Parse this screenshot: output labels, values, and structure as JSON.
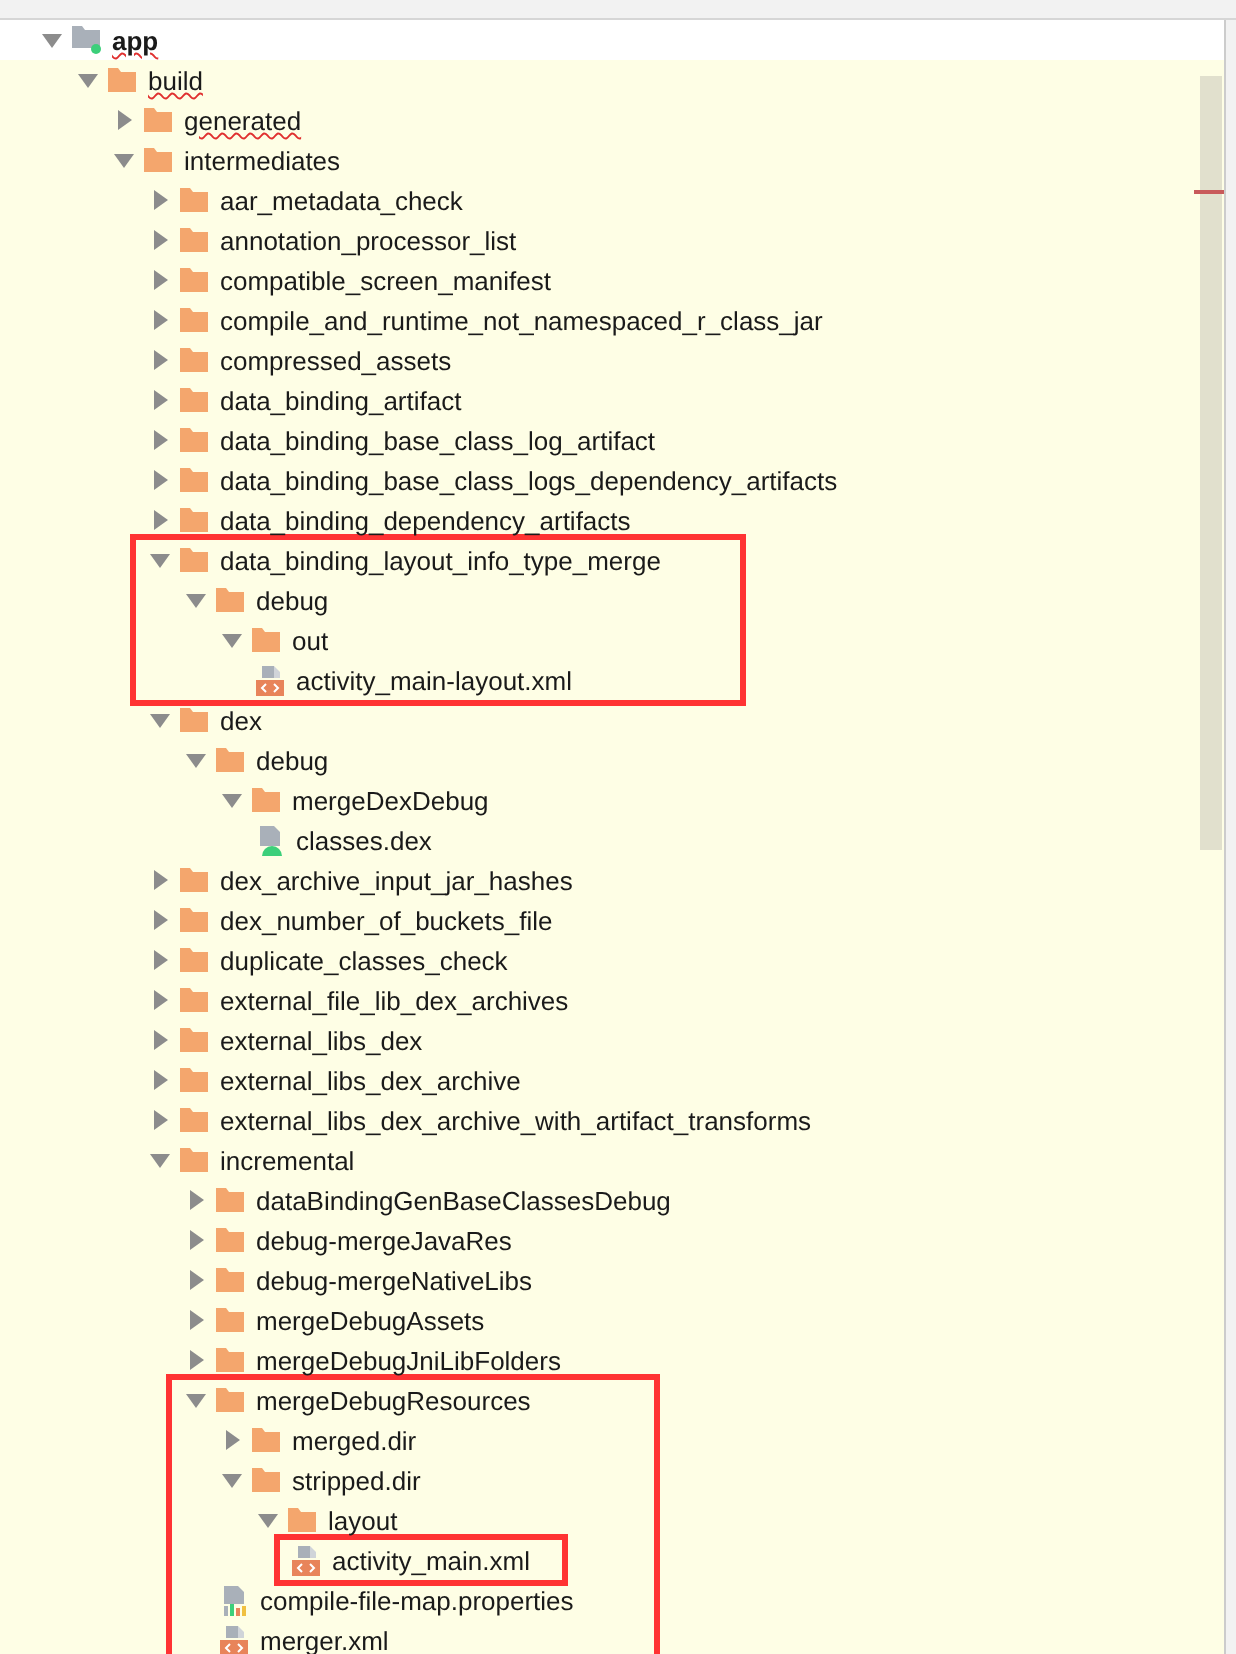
{
  "tree": [
    {
      "label": "app",
      "kind": "module",
      "expanded": true,
      "spellcheck_error": true,
      "children": [
        {
          "label": "build",
          "kind": "folder",
          "expanded": true,
          "spellcheck_error": true,
          "children": [
            {
              "label": "generated",
              "kind": "folder",
              "expanded": false,
              "spellcheck_error": true
            },
            {
              "label": "intermediates",
              "kind": "folder",
              "expanded": true,
              "children": [
                {
                  "label": "aar_metadata_check",
                  "kind": "folder",
                  "expanded": false
                },
                {
                  "label": "annotation_processor_list",
                  "kind": "folder",
                  "expanded": false
                },
                {
                  "label": "compatible_screen_manifest",
                  "kind": "folder",
                  "expanded": false
                },
                {
                  "label": "compile_and_runtime_not_namespaced_r_class_jar",
                  "kind": "folder",
                  "expanded": false
                },
                {
                  "label": "compressed_assets",
                  "kind": "folder",
                  "expanded": false
                },
                {
                  "label": "data_binding_artifact",
                  "kind": "folder",
                  "expanded": false
                },
                {
                  "label": "data_binding_base_class_log_artifact",
                  "kind": "folder",
                  "expanded": false
                },
                {
                  "label": "data_binding_base_class_logs_dependency_artifacts",
                  "kind": "folder",
                  "expanded": false
                },
                {
                  "label": "data_binding_dependency_artifacts",
                  "kind": "folder",
                  "expanded": false
                },
                {
                  "label": "data_binding_layout_info_type_merge",
                  "kind": "folder",
                  "expanded": true,
                  "highlighted": true,
                  "children": [
                    {
                      "label": "debug",
                      "kind": "folder",
                      "expanded": true,
                      "children": [
                        {
                          "label": "out",
                          "kind": "folder",
                          "expanded": true,
                          "children": [
                            {
                              "label": "activity_main-layout.xml",
                              "kind": "xml"
                            }
                          ]
                        }
                      ]
                    }
                  ]
                },
                {
                  "label": "dex",
                  "kind": "folder",
                  "expanded": true,
                  "children": [
                    {
                      "label": "debug",
                      "kind": "folder",
                      "expanded": true,
                      "children": [
                        {
                          "label": "mergeDexDebug",
                          "kind": "folder",
                          "expanded": true,
                          "children": [
                            {
                              "label": "classes.dex",
                              "kind": "dex"
                            }
                          ]
                        }
                      ]
                    }
                  ]
                },
                {
                  "label": "dex_archive_input_jar_hashes",
                  "kind": "folder",
                  "expanded": false
                },
                {
                  "label": "dex_number_of_buckets_file",
                  "kind": "folder",
                  "expanded": false
                },
                {
                  "label": "duplicate_classes_check",
                  "kind": "folder",
                  "expanded": false
                },
                {
                  "label": "external_file_lib_dex_archives",
                  "kind": "folder",
                  "expanded": false
                },
                {
                  "label": "external_libs_dex",
                  "kind": "folder",
                  "expanded": false
                },
                {
                  "label": "external_libs_dex_archive",
                  "kind": "folder",
                  "expanded": false
                },
                {
                  "label": "external_libs_dex_archive_with_artifact_transforms",
                  "kind": "folder",
                  "expanded": false
                },
                {
                  "label": "incremental",
                  "kind": "folder",
                  "expanded": true,
                  "children": [
                    {
                      "label": "dataBindingGenBaseClassesDebug",
                      "kind": "folder",
                      "expanded": false
                    },
                    {
                      "label": "debug-mergeJavaRes",
                      "kind": "folder",
                      "expanded": false
                    },
                    {
                      "label": "debug-mergeNativeLibs",
                      "kind": "folder",
                      "expanded": false
                    },
                    {
                      "label": "mergeDebugAssets",
                      "kind": "folder",
                      "expanded": false
                    },
                    {
                      "label": "mergeDebugJniLibFolders",
                      "kind": "folder",
                      "expanded": false
                    },
                    {
                      "label": "mergeDebugResources",
                      "kind": "folder",
                      "expanded": true,
                      "highlighted": true,
                      "children": [
                        {
                          "label": "merged.dir",
                          "kind": "folder",
                          "expanded": false
                        },
                        {
                          "label": "stripped.dir",
                          "kind": "folder",
                          "expanded": true,
                          "children": [
                            {
                              "label": "layout",
                              "kind": "folder",
                              "expanded": true,
                              "children": [
                                {
                                  "label": "activity_main.xml",
                                  "kind": "xml",
                                  "highlighted": true
                                }
                              ]
                            }
                          ]
                        },
                        {
                          "label": "compile-file-map.properties",
                          "kind": "properties"
                        },
                        {
                          "label": "merger.xml",
                          "kind": "xml"
                        }
                      ]
                    }
                  ]
                }
              ]
            }
          ]
        }
      ]
    }
  ]
}
